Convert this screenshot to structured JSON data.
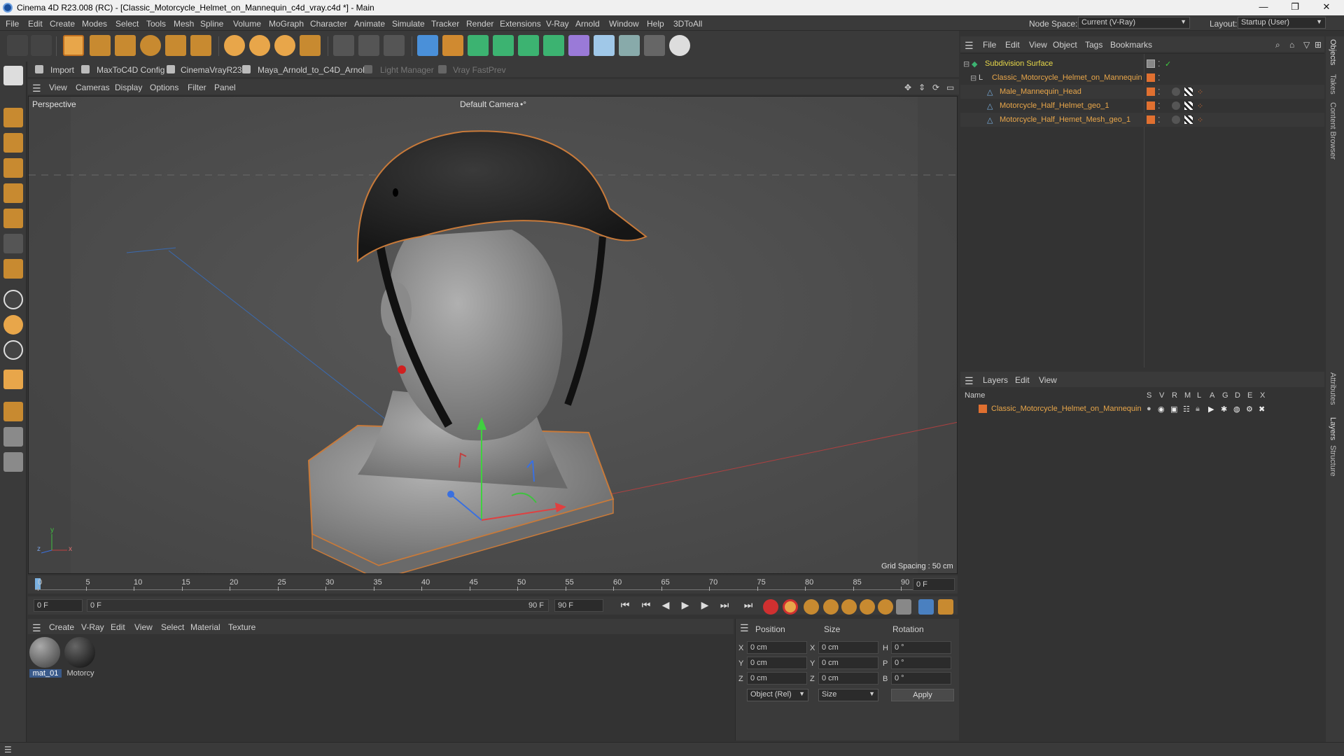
{
  "window": {
    "title": "Cinema 4D R23.008 (RC) - [Classic_Motorcycle_Helmet_on_Mannequin_c4d_vray.c4d *] - Main",
    "minimize": "—",
    "restore": "❐",
    "close": "✕"
  },
  "menubar": {
    "items": [
      "File",
      "Edit",
      "Create",
      "Modes",
      "Select",
      "Tools",
      "Mesh",
      "Spline",
      "Volume",
      "MoGraph",
      "Character",
      "Animate",
      "Simulate",
      "Tracker",
      "Render",
      "Extensions",
      "V-Ray",
      "Arnold",
      "Window",
      "Help",
      "3DToAll"
    ],
    "node_space_label": "Node Space:",
    "node_space_value": "Current (V-Ray)",
    "layout_label": "Layout:",
    "layout_value": "Startup (User)"
  },
  "pluginbar": {
    "items": [
      "Import",
      "MaxToC4D Config",
      "CinemaVrayR23",
      "Maya_Arnold_to_C4D_Arnold",
      "Light Manager",
      "Vray FastPrev"
    ]
  },
  "viewport": {
    "menu": [
      "View",
      "Cameras",
      "Display",
      "Options",
      "Filter",
      "Panel"
    ],
    "perspective_label": "Perspective",
    "camera_label": "Default Camera",
    "camera_glyph": "•°",
    "grid_spacing": "Grid Spacing : 50 cm",
    "axis_y": "y",
    "axis_z": "z",
    "axis_x": "x"
  },
  "timeline": {
    "ticks": [
      "0",
      "5",
      "10",
      "15",
      "20",
      "25",
      "30",
      "35",
      "40",
      "45",
      "50",
      "55",
      "60",
      "65",
      "70",
      "75",
      "80",
      "85",
      "90"
    ],
    "current_frame_field": "0 F",
    "start_field": "0 F",
    "range_start": "0 F",
    "range_end": "90 F",
    "end_field": "90 F"
  },
  "materials": {
    "menu": [
      "Create",
      "V-Ray",
      "Edit",
      "View",
      "Select",
      "Material",
      "Texture"
    ],
    "items": [
      {
        "name": "mat_01",
        "color": "#6a6a6a"
      },
      {
        "name": "Motorcy",
        "color": "#2a2a2a"
      }
    ]
  },
  "coordinates": {
    "headers": [
      "Position",
      "Size",
      "Rotation"
    ],
    "rows": [
      {
        "axis": "X",
        "pos": "0 cm",
        "size_axis": "X",
        "size": "0 cm",
        "rot_axis": "H",
        "rot": "0 °"
      },
      {
        "axis": "Y",
        "pos": "0 cm",
        "size_axis": "Y",
        "size": "0 cm",
        "rot_axis": "P",
        "rot": "0 °"
      },
      {
        "axis": "Z",
        "pos": "0 cm",
        "size_axis": "Z",
        "size": "0 cm",
        "rot_axis": "B",
        "rot": "0 °"
      }
    ],
    "mode_select": "Object (Rel)",
    "size_select": "Size",
    "apply": "Apply"
  },
  "objects": {
    "menu": [
      "File",
      "Edit",
      "View",
      "Object",
      "Tags",
      "Bookmarks"
    ],
    "rows": [
      {
        "name": "Subdivision Surface",
        "color": "#e8d84a"
      },
      {
        "name": "Classic_Motorcycle_Helmet_on_Mannequin",
        "color": "#e8a64a"
      },
      {
        "name": "Male_Mannequin_Head",
        "color": "#e8a64a"
      },
      {
        "name": "Motorcycle_Half_Helmet_geo_1",
        "color": "#e8a64a"
      },
      {
        "name": "Motorcycle_Half_Hemet_Mesh_geo_1",
        "color": "#e8a64a"
      }
    ]
  },
  "layers": {
    "menu": [
      "Layers",
      "Edit",
      "View"
    ],
    "columns": [
      "Name",
      "S",
      "V",
      "R",
      "M",
      "L",
      "A",
      "G",
      "D",
      "E",
      "X"
    ],
    "rows": [
      {
        "name": "Classic_Motorcycle_Helmet_on_Mannequin",
        "color": "#e07030"
      }
    ]
  },
  "right_tabs": [
    "Objects",
    "Takes",
    "Content Browser",
    "Attributes",
    "Layers",
    "Structure"
  ],
  "colors": {
    "accent": "#e8a64a",
    "bg": "#333333",
    "panel": "#3a3a3a"
  }
}
